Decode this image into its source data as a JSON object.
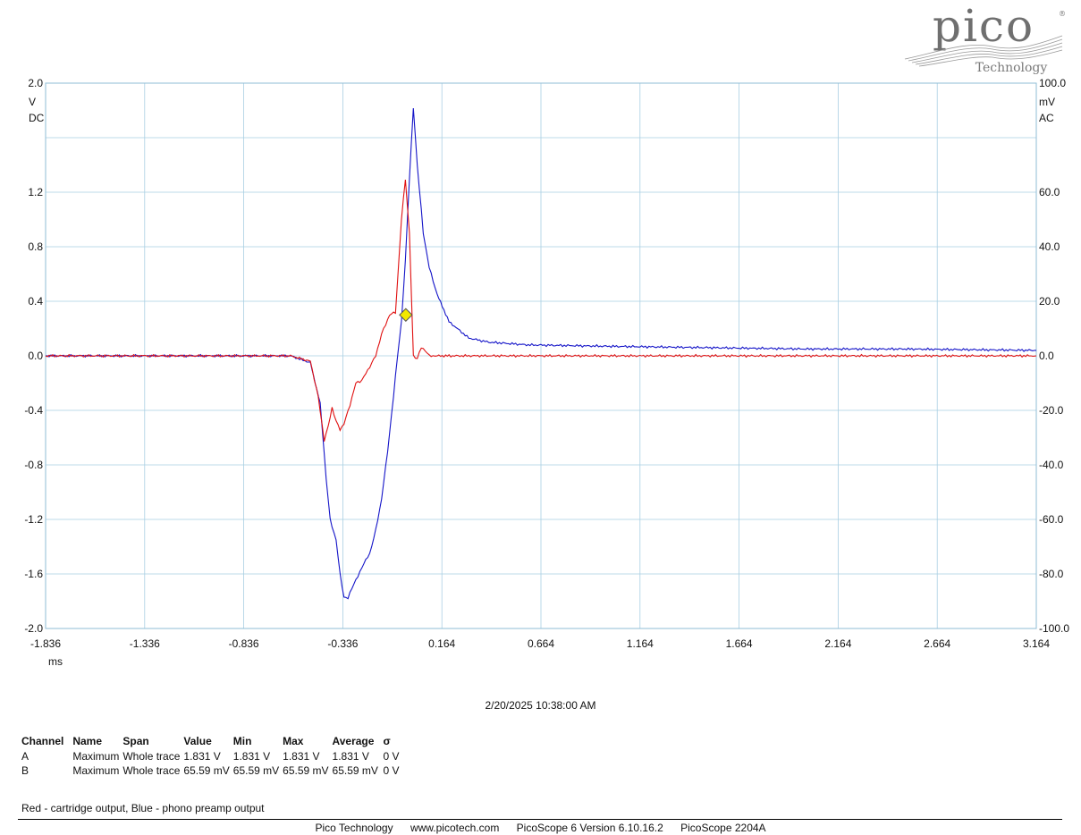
{
  "logo": {
    "brand": "pico",
    "sub": "Technology",
    "mark": "®"
  },
  "chart_data": {
    "type": "line",
    "x_unit": "ms",
    "x_ticks": [
      "-1.836",
      "-1.336",
      "-0.836",
      "-0.336",
      "0.164",
      "0.664",
      "1.164",
      "1.664",
      "2.164",
      "2.664",
      "3.164"
    ],
    "xlim": [
      -1.836,
      3.164
    ],
    "left_axis": {
      "unit": "V",
      "coupling": "DC",
      "ylim": [
        -2.0,
        2.0
      ],
      "ticks": [
        "2.0",
        "1.2",
        "0.8",
        "0.4",
        "0.0",
        "-0.4",
        "-0.8",
        "-1.2",
        "-1.6",
        "-2.0"
      ],
      "tick_values": [
        2.0,
        1.2,
        0.8,
        0.4,
        0.0,
        -0.4,
        -0.8,
        -1.2,
        -1.6,
        -2.0
      ]
    },
    "right_axis": {
      "unit": "mV",
      "coupling": "AC",
      "ylim": [
        -100,
        100
      ],
      "ticks": [
        "100.0",
        "60.0",
        "40.0",
        "20.0",
        "0.0",
        "-20.0",
        "-40.0",
        "-60.0",
        "-80.0",
        "-100.0"
      ],
      "tick_values": [
        100,
        60,
        40,
        20,
        0,
        -20,
        -40,
        -60,
        -80,
        -100
      ]
    },
    "grid": true,
    "series": [
      {
        "color": "#1414c8",
        "axis": "left",
        "x": [
          -1.836,
          -1.5,
          -1.0,
          -0.6,
          -0.5,
          -0.45,
          -0.42,
          -0.4,
          -0.37,
          -0.35,
          -0.33,
          -0.31,
          -0.29,
          -0.26,
          -0.24,
          -0.22,
          -0.2,
          -0.17,
          -0.14,
          -0.11,
          -0.08,
          -0.06,
          -0.04,
          -0.02,
          0.0,
          0.02,
          0.04,
          0.07,
          0.1,
          0.14,
          0.2,
          0.3,
          0.4,
          0.6,
          1.0,
          1.5,
          2.0,
          2.5,
          3.164
        ],
        "y": [
          0.0,
          0.0,
          0.0,
          0.0,
          -0.05,
          -0.35,
          -0.9,
          -1.2,
          -1.35,
          -1.6,
          -1.77,
          -1.78,
          -1.7,
          -1.62,
          -1.55,
          -1.5,
          -1.45,
          -1.28,
          -1.05,
          -0.7,
          -0.3,
          0.0,
          0.25,
          0.7,
          1.3,
          1.82,
          1.4,
          0.9,
          0.65,
          0.45,
          0.25,
          0.13,
          0.1,
          0.08,
          0.07,
          0.06,
          0.05,
          0.05,
          0.04
        ]
      },
      {
        "color": "#e01010",
        "axis": "right",
        "x": [
          -1.836,
          -1.5,
          -1.0,
          -0.6,
          -0.5,
          -0.46,
          -0.43,
          -0.41,
          -0.39,
          -0.37,
          -0.35,
          -0.33,
          -0.3,
          -0.27,
          -0.24,
          -0.2,
          -0.17,
          -0.14,
          -0.1,
          -0.07,
          -0.04,
          -0.02,
          0.0,
          0.02,
          0.04,
          0.06,
          0.08,
          0.1,
          0.14,
          0.2,
          0.5,
          1.0,
          1.5,
          2.0,
          2.5,
          3.164
        ],
        "y": [
          0.0,
          0.0,
          0.0,
          0.0,
          -2,
          -15,
          -31,
          -26,
          -19,
          -24,
          -27,
          -25,
          -18,
          -10,
          -9,
          -4,
          0,
          8,
          15,
          16,
          50,
          65,
          45,
          0,
          -1,
          3,
          2,
          0,
          0,
          0,
          0,
          0,
          0,
          0,
          0,
          0
        ]
      }
    ],
    "cursor": {
      "x": -0.0,
      "y": 0.3,
      "color": "#f2e800"
    }
  },
  "timestamp": "2/20/2025 10:38:00 AM",
  "measurements": {
    "headers": [
      "Channel",
      "Name",
      "Span",
      "Value",
      "Min",
      "Max",
      "Average",
      "σ"
    ],
    "rows": [
      [
        "A",
        "Maximum",
        "Whole trace",
        "1.831 V",
        "1.831 V",
        "1.831 V",
        "1.831 V",
        "0 V"
      ],
      [
        "B",
        "Maximum",
        "Whole trace",
        "65.59 mV",
        "65.59 mV",
        "65.59 mV",
        "65.59 mV",
        "0 V"
      ]
    ]
  },
  "note": "Red - cartridge output,  Blue - phono preamp output",
  "footer": [
    "Pico Technology",
    "www.picotech.com",
    "PicoScope 6 Version 6.10.16.2",
    "PicoScope 2204A"
  ]
}
